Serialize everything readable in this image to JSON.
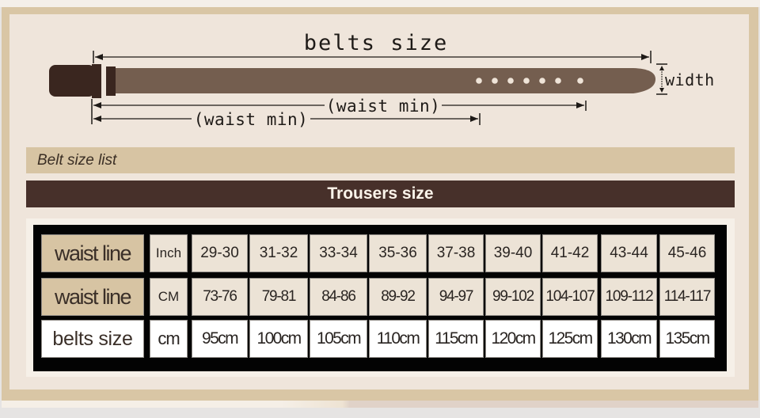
{
  "diagram": {
    "title": "belts size",
    "waist_max_label": "(waist min)",
    "waist_min_label": "(waist min)",
    "width_label": "width",
    "belt_colors": {
      "buckle": "#3a261f",
      "strap": "#745e4f",
      "holes": "#efe4d8"
    }
  },
  "belt_size_list_label": "Belt size list",
  "trousers_size_header": "Trousers size",
  "size_table": {
    "rows": [
      {
        "label": "waist line",
        "unit": "Inch",
        "values": [
          "29-30",
          "31-32",
          "33-34",
          "35-36",
          "37-38",
          "39-40",
          "41-42",
          "43-44",
          "45-46"
        ]
      },
      {
        "label": "waist line",
        "unit": "CM",
        "values": [
          "73-76",
          "79-81",
          "84-86",
          "89-92",
          "94-97",
          "99-102",
          "104-107",
          "109-112",
          "114-117"
        ]
      },
      {
        "label": "belts size",
        "unit": "cm",
        "values": [
          "95cm",
          "100cm",
          "105cm",
          "110cm",
          "115cm",
          "120cm",
          "125cm",
          "130cm",
          "135cm"
        ]
      }
    ]
  },
  "colors": {
    "frame": "#d9c6a5",
    "panel": "#efe5db",
    "header_dark": "#47302a",
    "header_light": "#d7c4a3",
    "table_bg": "#030303"
  }
}
